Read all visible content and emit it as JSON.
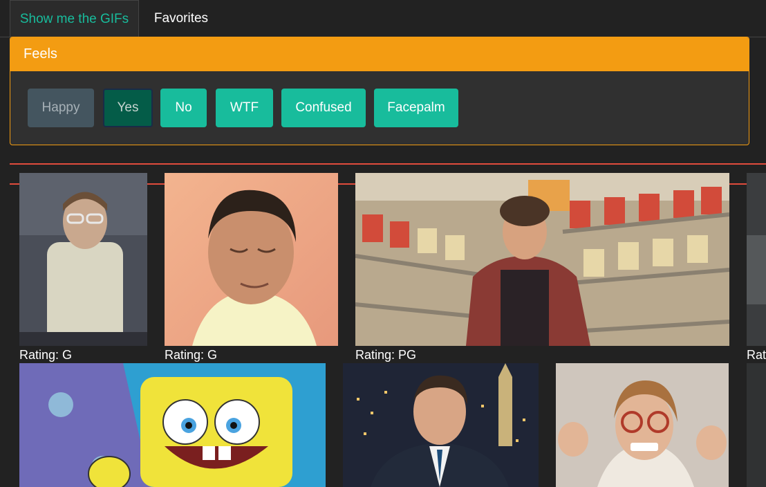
{
  "tabs": [
    {
      "label": "Show me the GIFs",
      "active": true
    },
    {
      "label": "Favorites",
      "active": false
    }
  ],
  "panel": {
    "title": "Feels",
    "buttons": [
      {
        "label": "Happy",
        "state": "disabled"
      },
      {
        "label": "Yes",
        "state": "active"
      },
      {
        "label": "No",
        "state": "normal"
      },
      {
        "label": "WTF",
        "state": "normal"
      },
      {
        "label": "Confused",
        "state": "normal"
      },
      {
        "label": "Facepalm",
        "state": "normal"
      }
    ]
  },
  "gifs": [
    {
      "rating": "Rating: G",
      "icon": "man-with-glasses-gif"
    },
    {
      "rating": "Rating: G",
      "icon": "man-looking-down-gif"
    },
    {
      "rating": "Rating: PG",
      "icon": "grocery-store-man-gif"
    },
    {
      "rating": "Rat",
      "icon": "cropped-gif"
    },
    {
      "rating": "",
      "icon": "spongebob-gif"
    },
    {
      "rating": "",
      "icon": "late-night-host-gif"
    },
    {
      "rating": "",
      "icon": "excited-woman-gif"
    }
  ],
  "colors": {
    "accent": "#18bc9c",
    "warning": "#f39c12",
    "danger": "#e04b3c",
    "background": "#222222"
  }
}
